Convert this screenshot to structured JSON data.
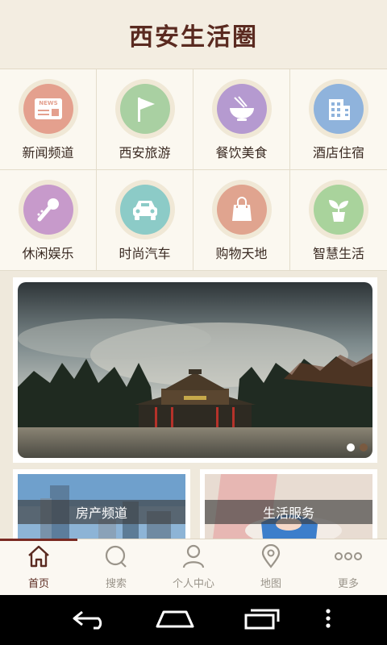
{
  "header": {
    "title": "西安生活圈"
  },
  "categories": [
    {
      "label": "新闻频道",
      "icon": "news-icon",
      "color": "#e4a08e",
      "badge": "NEWS"
    },
    {
      "label": "西安旅游",
      "icon": "flag-icon",
      "color": "#a9d0a2"
    },
    {
      "label": "餐饮美食",
      "icon": "noodle-bowl-icon",
      "color": "#b59ad0"
    },
    {
      "label": "酒店住宿",
      "icon": "building-icon",
      "color": "#8fb3dc"
    },
    {
      "label": "休闲娱乐",
      "icon": "microphone-icon",
      "color": "#c79acb"
    },
    {
      "label": "时尚汽车",
      "icon": "car-icon",
      "color": "#8ccbc7"
    },
    {
      "label": "购物天地",
      "icon": "shopping-bag-icon",
      "color": "#e0a48f"
    },
    {
      "label": "智慧生活",
      "icon": "plant-icon",
      "color": "#a9d39c"
    }
  ],
  "banner": {
    "slides_total": 2,
    "active_slide": 1
  },
  "cards": [
    {
      "caption": "房产频道"
    },
    {
      "caption": "生活服务"
    }
  ],
  "tabs": [
    {
      "label": "首页",
      "icon": "home-icon",
      "active": true
    },
    {
      "label": "搜索",
      "icon": "search-icon",
      "active": false
    },
    {
      "label": "个人中心",
      "icon": "user-icon",
      "active": false
    },
    {
      "label": "地图",
      "icon": "map-pin-icon",
      "active": false
    },
    {
      "label": "更多",
      "icon": "more-icon",
      "active": false
    }
  ],
  "system_nav": [
    "back-icon",
    "home-nav-icon",
    "recents-icon",
    "overflow-icon"
  ]
}
